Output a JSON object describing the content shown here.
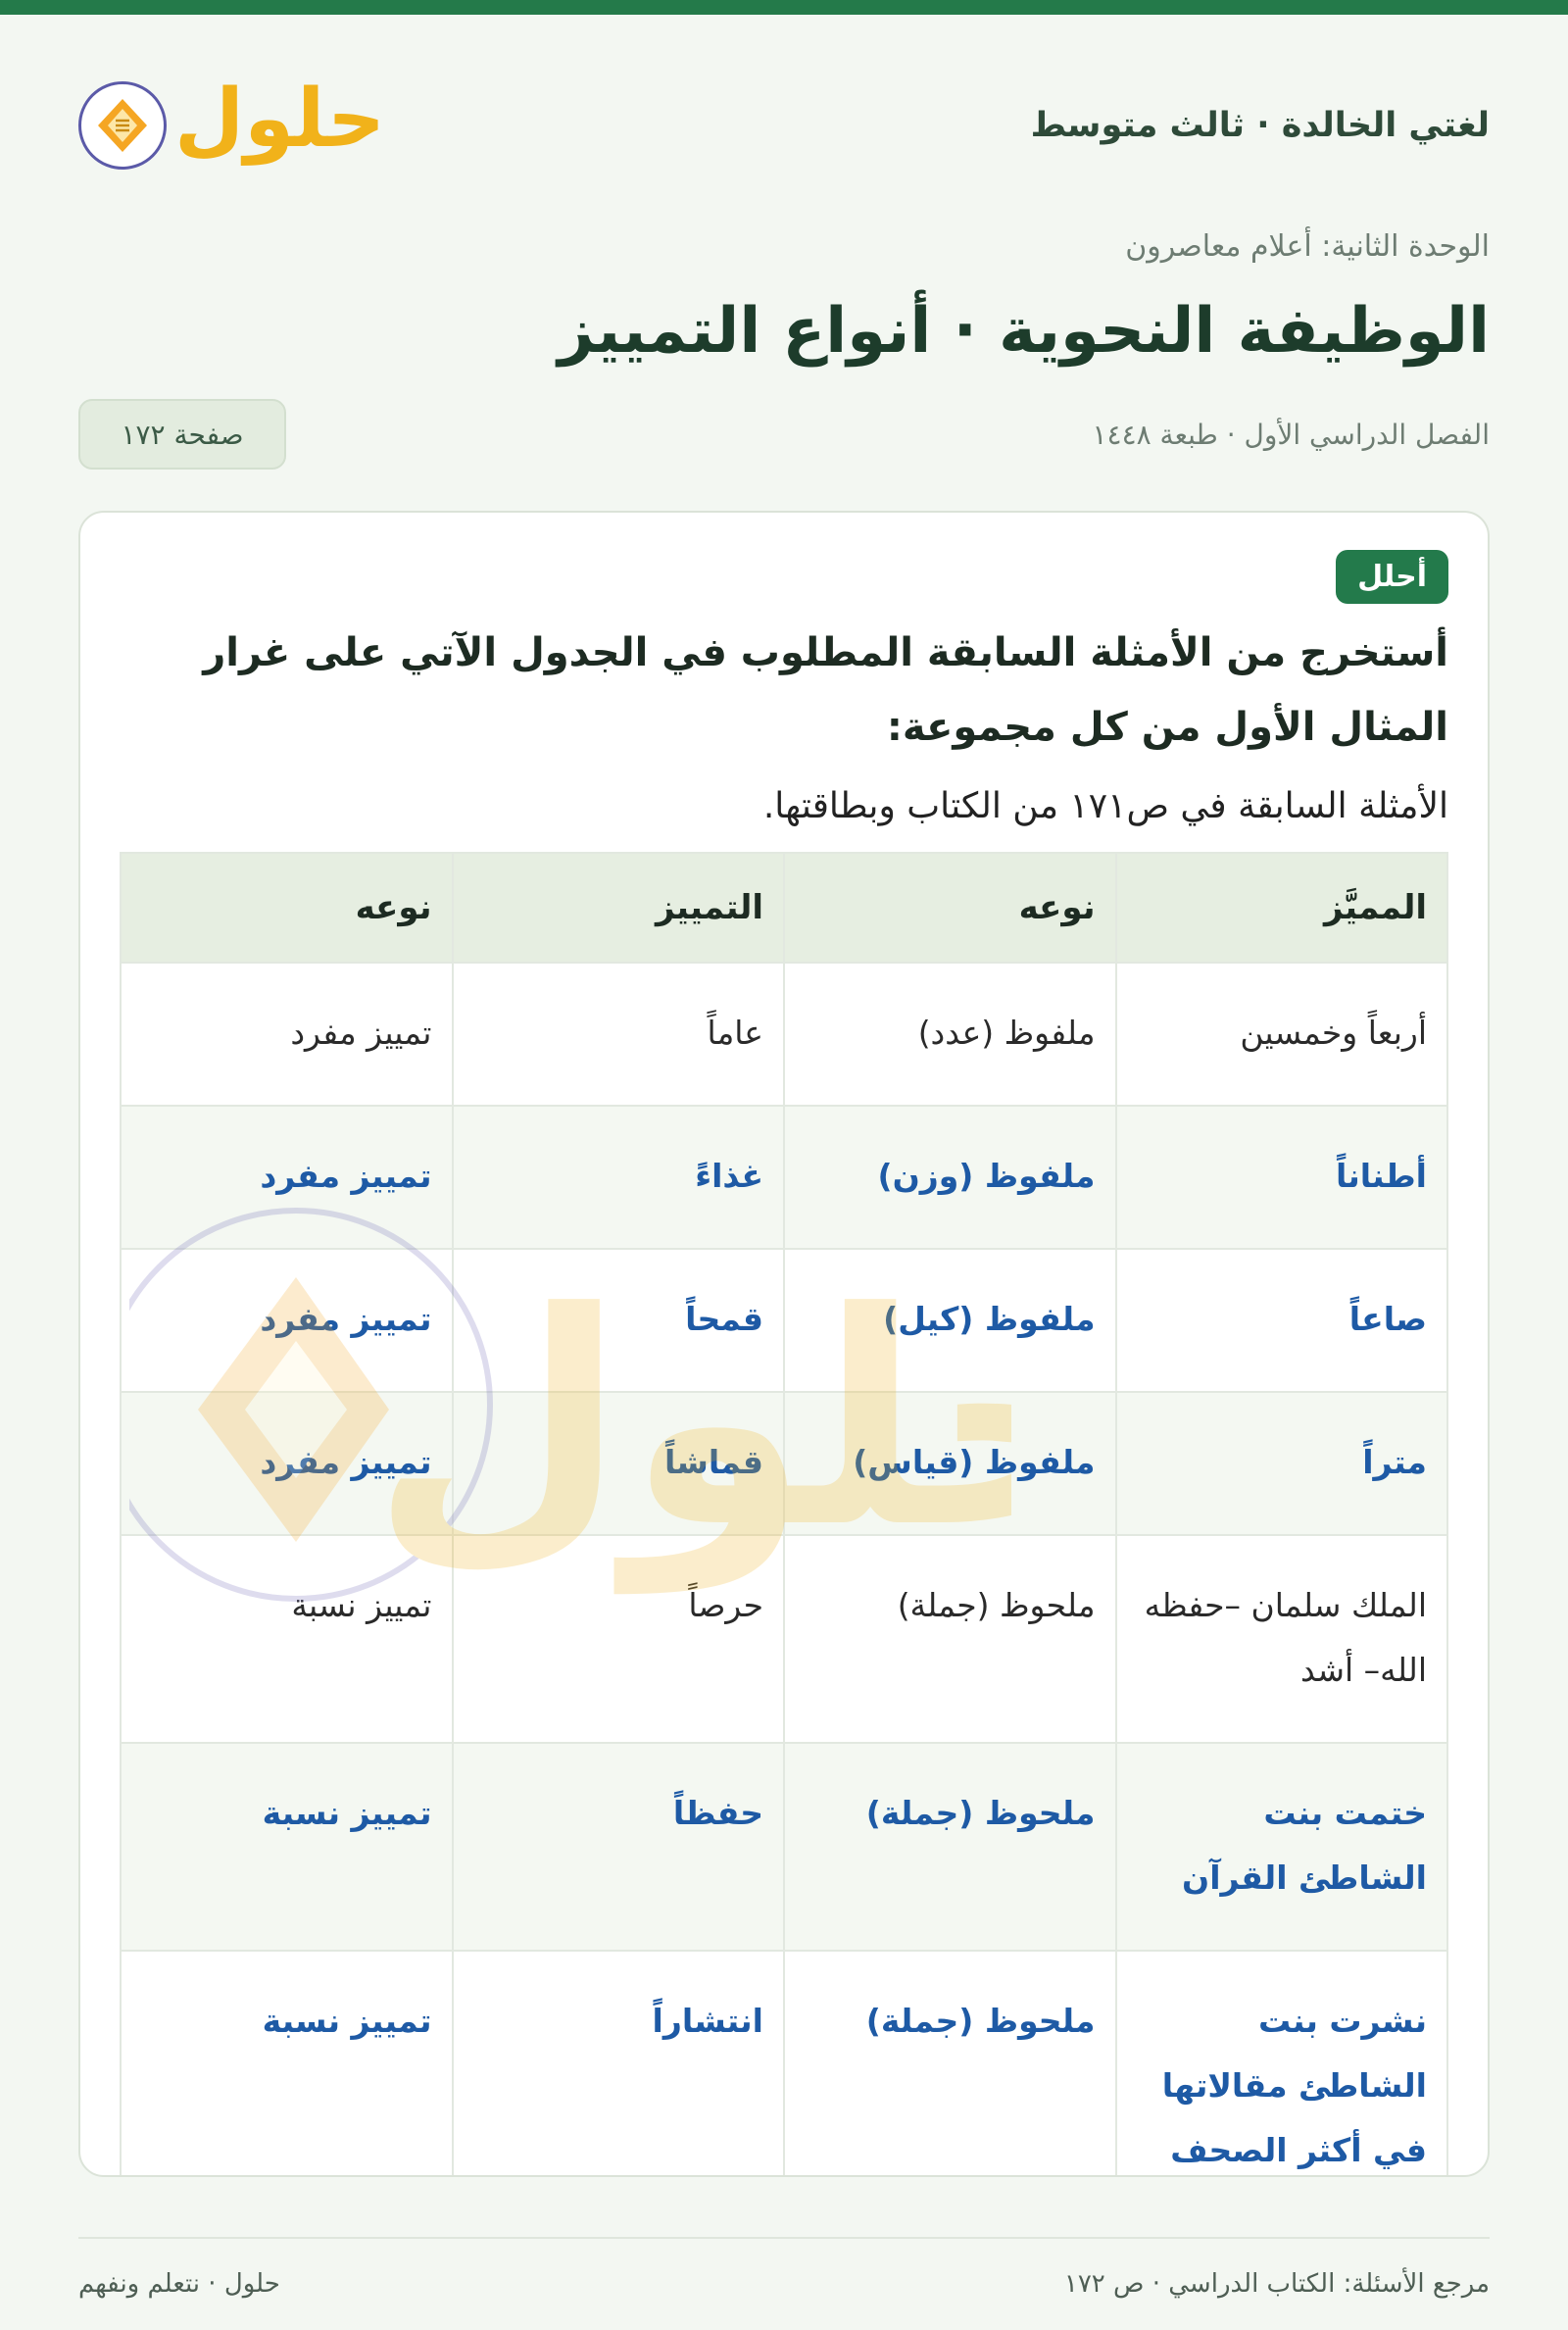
{
  "header": {
    "course_title": "لغتي الخالدة · ثالث متوسط",
    "logo_text": "حلول"
  },
  "unit": "الوحدة الثانية: أعلام معاصرون",
  "main_title": "الوظيفة النحوية · أنواع التمييز",
  "semester": "الفصل الدراسي الأول · طبعة ١٤٤٨",
  "page_badge": "صفحة ١٧٢",
  "card": {
    "tag": "أحلل",
    "instruction": "أستخرج من الأمثلة السابقة المطلوب في الجدول الآتي على غرار المثال الأول من كل مجموعة:",
    "reference": "الأمثلة السابقة في ص١٧١ من الكتاب وبطاقتها."
  },
  "table": {
    "headers": [
      "المميَّز",
      "نوعه",
      "التمييز",
      "نوعه"
    ],
    "rows": [
      [
        "أربعاً وخمسين",
        "ملفوظ (عدد)",
        "عاماً",
        "تمييز مفرد"
      ],
      [
        "أطناناً",
        "ملفوظ (وزن)",
        "غذاءً",
        "تمييز مفرد"
      ],
      [
        "صاعاً",
        "ملفوظ (كيل)",
        "قمحاً",
        "تمييز مفرد"
      ],
      [
        "متراً",
        "ملفوظ (قياس)",
        "قماشاً",
        "تمييز مفرد"
      ],
      [
        "الملك سلمان –حفظه الله– أشد",
        "ملحوظ (جملة)",
        "حرصاً",
        "تمييز نسبة"
      ],
      [
        "ختمت بنت الشاطئ القرآن",
        "ملحوظ (جملة)",
        "حفظاً",
        "تمييز نسبة"
      ],
      [
        "نشرت بنت الشاطئ مقالاتها في أكثر الصحف",
        "ملحوظ (جملة)",
        "انتشاراً",
        "تمييز نسبة"
      ],
      [
        "",
        "",
        "",
        ""
      ]
    ]
  },
  "footer": {
    "right": "مرجع الأسئلة: الكتاب الدراسي · ص ١٧٢",
    "left": "حلول · نتعلم ونفهم"
  },
  "colors": {
    "brand_green": "#247a4a",
    "answer_blue": "#1e5aa5",
    "logo_yellow": "#f1b21a"
  }
}
